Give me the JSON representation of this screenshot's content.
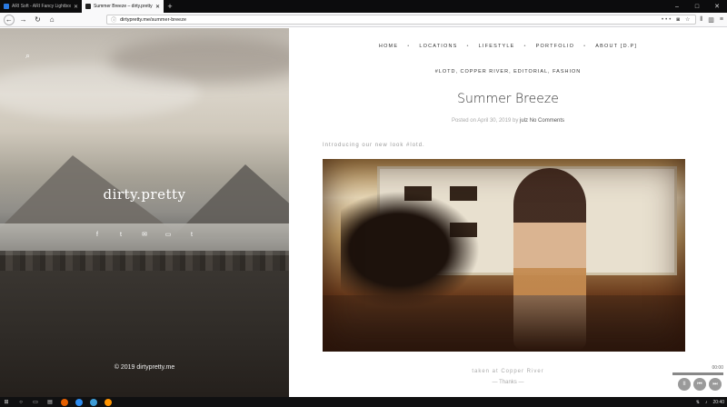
{
  "browser": {
    "tabs": [
      {
        "title": "ARI Soft - ARI Fancy Lightbox -",
        "active": false
      },
      {
        "title": "Summer Breeze – dirty.pretty",
        "active": true
      }
    ],
    "new_tab": "+",
    "url_host": "dirtypretty.me",
    "url_path": "/summer-breeze",
    "url_more": "•••",
    "window_controls": {
      "min": "–",
      "max": "□",
      "close": "✕"
    }
  },
  "sidebar": {
    "logo": "dirty.pretty",
    "copyright": "© 2019 dirtypretty.me",
    "social": [
      "f",
      "t",
      "✉",
      "▭",
      "t"
    ]
  },
  "nav": {
    "items": [
      "HOME",
      "LOCATIONS",
      "LIFESTYLE",
      "PORTFOLIO",
      "ABOUT [D.P]"
    ]
  },
  "post": {
    "categories": "#LOTD, COPPER RIVER, EDITORIAL, FASHION",
    "title": "Summer Breeze",
    "posted_on": "Posted on April 30, 2019",
    "by": "by",
    "author": "julz",
    "comments": "No Comments",
    "intro": "Introducing our new look #lotd.",
    "caption": "taken at Copper River",
    "caption2": "— Thanks —"
  },
  "player": {
    "time": "00:00",
    "buttons": [
      "II",
      "⏮",
      "⏭"
    ]
  },
  "taskbar": {
    "clock": "20:40"
  }
}
